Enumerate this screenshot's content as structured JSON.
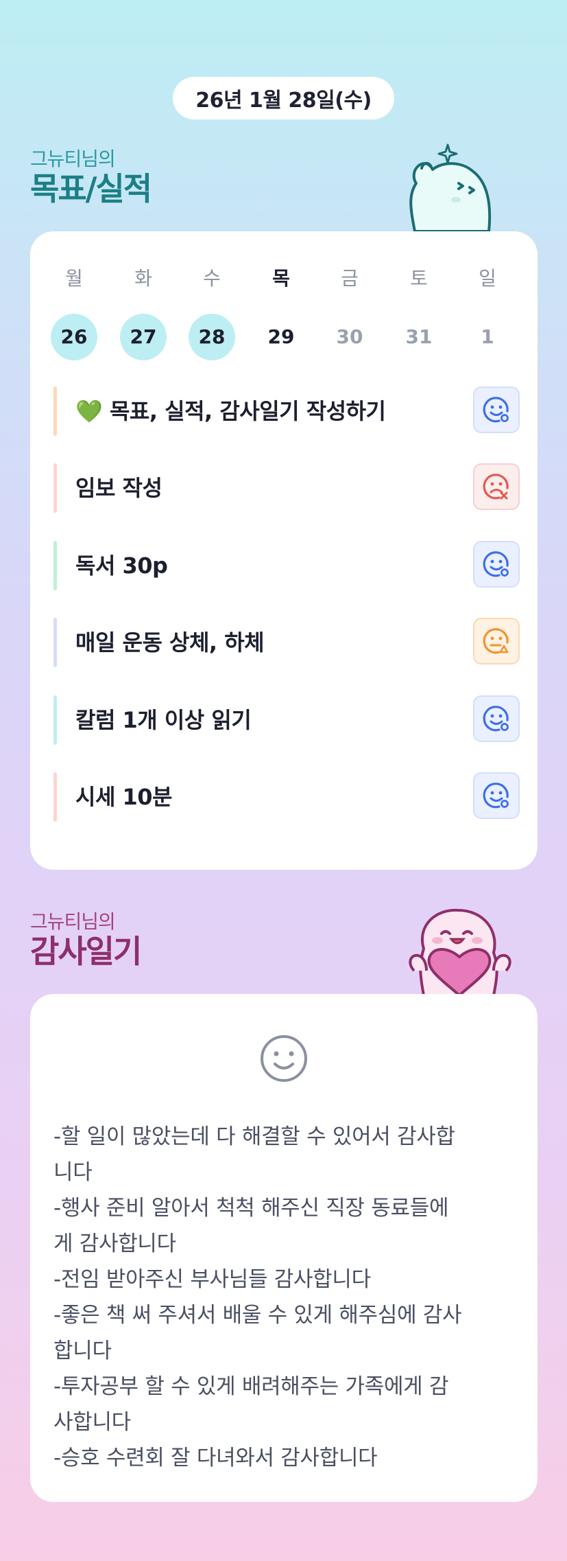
{
  "date_label": "26년 1월 28일(수)",
  "goal_section": {
    "subtitle": "그뉴티님의",
    "title": "목표/실적"
  },
  "week": [
    {
      "name": "월",
      "num": "26"
    },
    {
      "name": "화",
      "num": "27"
    },
    {
      "name": "수",
      "num": "28"
    },
    {
      "name": "목",
      "num": "29"
    },
    {
      "name": "금",
      "num": "30"
    },
    {
      "name": "토",
      "num": "31"
    },
    {
      "name": "일",
      "num": "1"
    }
  ],
  "goals": [
    {
      "text": "💚 목표, 실적, 감사일기 작성하기",
      "status": "done",
      "bar_color": "#fcd9b8"
    },
    {
      "text": "임보 작성",
      "status": "fail",
      "bar_color": "#fdd4cf"
    },
    {
      "text": "독서 30p",
      "status": "done",
      "bar_color": "#bff0d8"
    },
    {
      "text": "매일 운동 상체, 하체",
      "status": "partial",
      "bar_color": "#d8dcfb"
    },
    {
      "text": "칼럼 1개 이상 읽기",
      "status": "done",
      "bar_color": "#bdeef3"
    },
    {
      "text": "시세 10분",
      "status": "done",
      "bar_color": "#fdd4cf"
    }
  ],
  "diary_section": {
    "subtitle": "그뉴티님의",
    "title": "감사일기"
  },
  "diary_lines": [
    "-할 일이 많았는데 다 해결할 수 있어서 감사합",
    "니다",
    "-행사 준비 알아서 척척 해주신 직장 동료들에",
    "게 감사합니다",
    "-전임 받아주신 부사님들 감사합니다",
    "-좋은 책 써 주셔서 배울 수 있게 해주심에 감사",
    "합니다",
    "-투자공부 할 수 있게 배려해주는 가족에게 감",
    "사합니다",
    "-승호 수련회 잘 다녀와서 감사합니다"
  ],
  "colors": {
    "done_icon": "#3d6ee8",
    "fail_icon": "#e5574f",
    "partial_icon": "#f0922e",
    "selected_day": "#bdeef3"
  },
  "icons": {
    "done": "smile-check-icon",
    "fail": "sad-x-icon",
    "partial": "neutral-warning-icon",
    "diary": "smiley-face-icon"
  }
}
